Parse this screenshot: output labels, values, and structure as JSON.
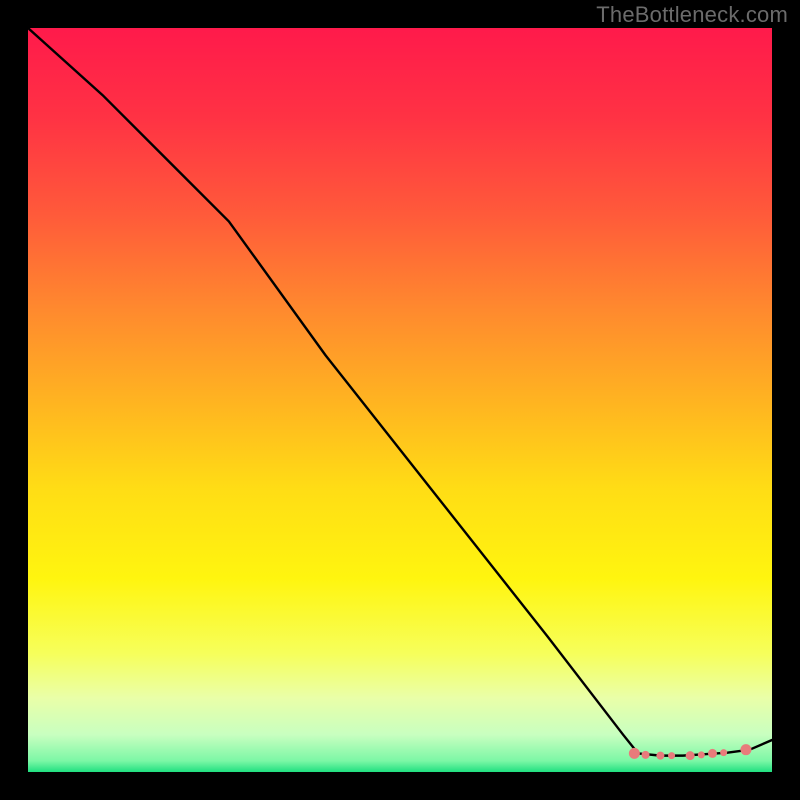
{
  "watermark": "TheBottleneck.com",
  "chart_data": {
    "type": "line",
    "title": "",
    "xlabel": "",
    "ylabel": "",
    "xlim": [
      0,
      100
    ],
    "ylim": [
      0,
      100
    ],
    "background_gradient": {
      "stops": [
        {
          "offset": 0.0,
          "color": "#ff1a4b"
        },
        {
          "offset": 0.12,
          "color": "#ff3244"
        },
        {
          "offset": 0.25,
          "color": "#ff5a3a"
        },
        {
          "offset": 0.38,
          "color": "#ff8a2e"
        },
        {
          "offset": 0.5,
          "color": "#ffb321"
        },
        {
          "offset": 0.62,
          "color": "#ffdd15"
        },
        {
          "offset": 0.74,
          "color": "#fff50f"
        },
        {
          "offset": 0.84,
          "color": "#f6ff5a"
        },
        {
          "offset": 0.9,
          "color": "#eaffa8"
        },
        {
          "offset": 0.95,
          "color": "#c8ffc0"
        },
        {
          "offset": 0.985,
          "color": "#7cf7a6"
        },
        {
          "offset": 1.0,
          "color": "#20e080"
        }
      ]
    },
    "series": [
      {
        "name": "bottleneck-curve",
        "color": "#000000",
        "x": [
          0,
          10,
          20,
          27,
          40,
          55,
          70,
          80,
          82,
          85,
          88,
          91,
          94,
          97,
          100
        ],
        "y": [
          100,
          91,
          81,
          74,
          56,
          37,
          18,
          5,
          2.5,
          2.2,
          2.2,
          2.4,
          2.6,
          3.0,
          4.3
        ]
      }
    ],
    "markers": [
      {
        "name": "flat-region-dot-1",
        "x": 81.5,
        "y": 2.5,
        "color": "#e87b7b",
        "r": 5.5
      },
      {
        "name": "flat-region-dot-2",
        "x": 83.0,
        "y": 2.3,
        "color": "#e87b7b",
        "r": 4.0
      },
      {
        "name": "flat-region-dot-3",
        "x": 85.0,
        "y": 2.2,
        "color": "#e87b7b",
        "r": 4.0
      },
      {
        "name": "flat-region-dot-4",
        "x": 86.5,
        "y": 2.2,
        "color": "#e87b7b",
        "r": 3.5
      },
      {
        "name": "flat-region-dot-5",
        "x": 89.0,
        "y": 2.2,
        "color": "#e87b7b",
        "r": 4.5
      },
      {
        "name": "flat-region-dot-6",
        "x": 90.5,
        "y": 2.3,
        "color": "#e87b7b",
        "r": 3.5
      },
      {
        "name": "flat-region-dot-7",
        "x": 92.0,
        "y": 2.5,
        "color": "#e87b7b",
        "r": 4.5
      },
      {
        "name": "flat-region-dot-8",
        "x": 93.5,
        "y": 2.6,
        "color": "#e87b7b",
        "r": 3.5
      },
      {
        "name": "flat-region-dot-9",
        "x": 96.5,
        "y": 3.0,
        "color": "#e87b7b",
        "r": 5.5
      }
    ]
  }
}
